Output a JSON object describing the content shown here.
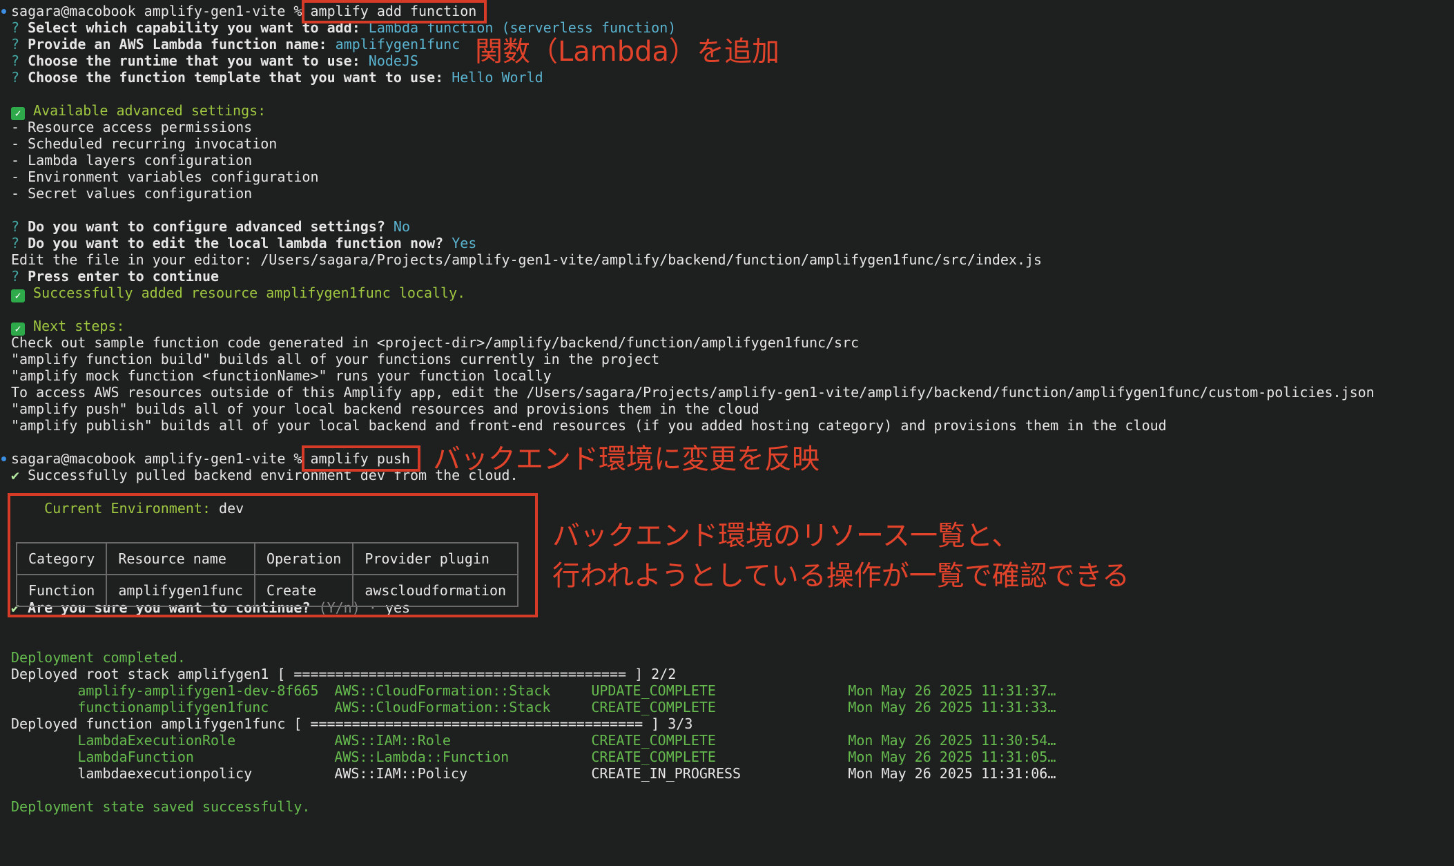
{
  "prompt": "sagara@macobook amplify-gen1-vite %",
  "block1": {
    "command": "amplify add function",
    "questions": [
      {
        "q": "Select which capability you want to add:",
        "a": "Lambda function (serverless function)"
      },
      {
        "q": "Provide an AWS Lambda function name:",
        "a": "amplifygen1func"
      },
      {
        "q": "Choose the runtime that you want to use:",
        "a": "NodeJS"
      },
      {
        "q": "Choose the function template that you want to use:",
        "a": "Hello World"
      }
    ],
    "advanced_title": "Available advanced settings:",
    "advanced_items": [
      "- Resource access permissions",
      "- Scheduled recurring invocation",
      "- Lambda layers configuration",
      "- Environment variables configuration",
      "- Secret values configuration"
    ],
    "q_configure": {
      "q": "Do you want to configure advanced settings?",
      "a": "No"
    },
    "q_edit": {
      "q": "Do you want to edit the local lambda function now?",
      "a": "Yes"
    },
    "edit_path": "Edit the file in your editor: /Users/sagara/Projects/amplify-gen1-vite/amplify/backend/function/amplifygen1func/src/index.js",
    "press_enter": "Press enter to continue",
    "success": "Successfully added resource amplifygen1func locally.",
    "next_title": "Next steps:",
    "next_lines": [
      "Check out sample function code generated in <project-dir>/amplify/backend/function/amplifygen1func/src",
      "\"amplify function build\" builds all of your functions currently in the project",
      "\"amplify mock function <functionName>\" runs your function locally",
      "To access AWS resources outside of this Amplify app, edit the /Users/sagara/Projects/amplify-gen1-vite/amplify/backend/function/amplifygen1func/custom-policies.json",
      "\"amplify push\" builds all of your local backend resources and provisions them in the cloud",
      "\"amplify publish\" builds all of your local backend and front-end resources (if you added hosting category) and provisions them in the cloud"
    ]
  },
  "block2": {
    "command": "amplify push",
    "pulled": "Successfully pulled backend environment dev from the cloud.",
    "env_label": "Current Environment:",
    "env_value": "dev",
    "table_headers": [
      "Category",
      "Resource name",
      "Operation",
      "Provider plugin"
    ],
    "table_rows": [
      [
        "Function",
        "amplifygen1func",
        "Create",
        "awscloudformation"
      ]
    ],
    "confirm_q": "Are you sure you want to continue?",
    "confirm_hint": "(Y/n)",
    "confirm_sep": "·",
    "confirm_a": "yes",
    "deploy_done": "Deployment completed.",
    "root_stack": "Deployed root stack amplifygen1 [ ======================================== ] 2/2",
    "root_rows": [
      [
        "amplify-amplifygen1-dev-8f665",
        "AWS::CloudFormation::Stack",
        "UPDATE_COMPLETE",
        "Mon May 26 2025 11:31:37…"
      ],
      [
        "functionamplifygen1func",
        "AWS::CloudFormation::Stack",
        "CREATE_COMPLETE",
        "Mon May 26 2025 11:31:33…"
      ]
    ],
    "func_stack": "Deployed function amplifygen1func [ ======================================== ] 3/3",
    "func_rows": [
      [
        "LambdaExecutionRole",
        "AWS::IAM::Role",
        "CREATE_COMPLETE",
        "Mon May 26 2025 11:30:54…"
      ],
      [
        "LambdaFunction",
        "AWS::Lambda::Function",
        "CREATE_COMPLETE",
        "Mon May 26 2025 11:31:05…"
      ]
    ],
    "func_pending_row": [
      "lambdaexecutionpolicy",
      "AWS::IAM::Policy",
      "CREATE_IN_PROGRESS",
      "Mon May 26 2025 11:31:06…"
    ],
    "state_saved": "Deployment state saved successfully."
  },
  "annotations": {
    "add_function": "関数（Lambda）を追加",
    "push": "バックエンド環境に変更を反映",
    "table_line1": "バックエンド環境のリソース一覧と、",
    "table_line2": "行われようとしている操作が一覧で確認できる"
  },
  "colors": {
    "highlight_box": "#d63b28",
    "annotation_text": "#e2432b",
    "success": "#9fc740",
    "answer": "#5ab4d0"
  }
}
